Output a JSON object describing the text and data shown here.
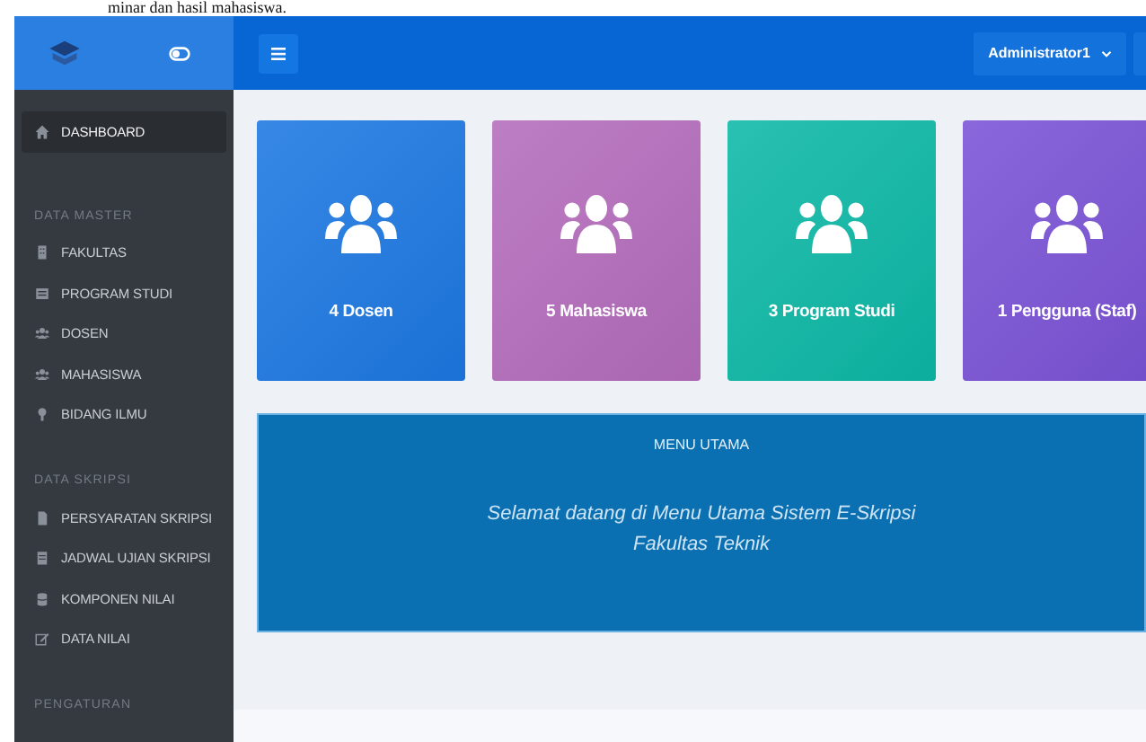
{
  "document_text": "minar dan hasil mahasiswa.",
  "sidebar": {
    "items": [
      {
        "kind": "item",
        "label": "DASHBOARD",
        "selected": true
      },
      {
        "kind": "heading",
        "label": "DATA MASTER"
      },
      {
        "kind": "item",
        "label": "FAKULTAS",
        "selected": false
      },
      {
        "kind": "item",
        "label": "PROGRAM STUDI",
        "selected": false
      },
      {
        "kind": "item",
        "label": "DOSEN",
        "selected": false
      },
      {
        "kind": "item",
        "label": "MAHASISWA",
        "selected": false
      },
      {
        "kind": "item",
        "label": "BIDANG ILMU",
        "selected": false
      },
      {
        "kind": "heading",
        "label": "DATA SKRIPSI"
      },
      {
        "kind": "item",
        "label": "PERSYARATAN SKRIPSI",
        "selected": false
      },
      {
        "kind": "item",
        "label": "JADWAL UJIAN SKRIPSI",
        "selected": false
      },
      {
        "kind": "item",
        "label": "KOMPONEN NILAI",
        "selected": false
      },
      {
        "kind": "item",
        "label": "DATA NILAI",
        "selected": false
      },
      {
        "kind": "heading",
        "label": "PENGATURAN"
      }
    ]
  },
  "topbar": {
    "user": "Administrator1"
  },
  "cards": [
    {
      "label": "4 Dosen",
      "color": "#1c78e2"
    },
    {
      "label": "5 Mahasiswa",
      "color": "#b46cbc"
    },
    {
      "label": "3 Program Studi",
      "color": "#0cb8a6"
    },
    {
      "label": "1 Pengguna (Staf)",
      "color": "#7a52d6"
    }
  ],
  "banner": {
    "title": "MENU UTAMA",
    "lines": [
      "Selamat datang di Menu Utama Sistem E-Skripsi",
      "Fakultas Teknik"
    ]
  }
}
